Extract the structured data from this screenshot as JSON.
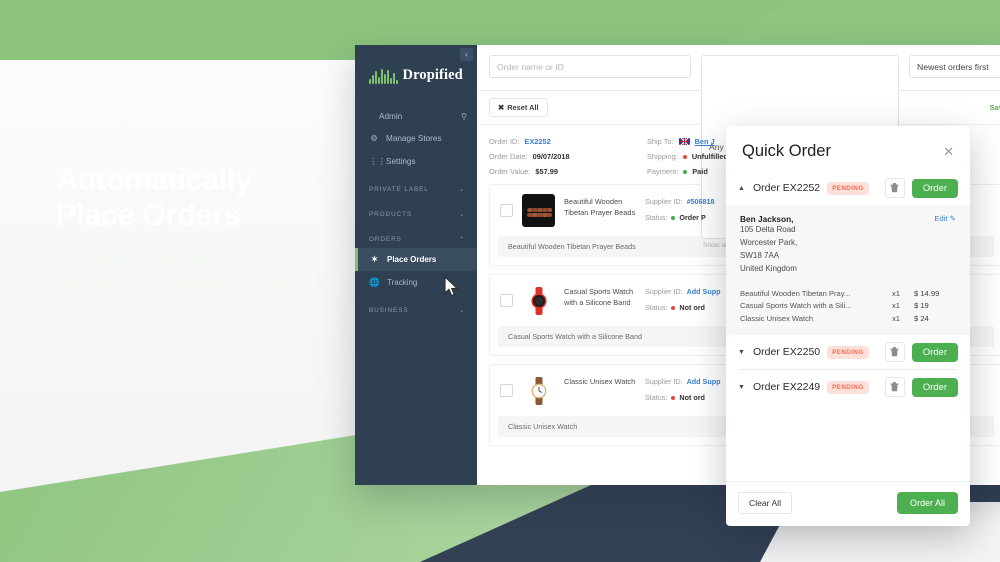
{
  "promo": {
    "headline_line1": "Automatically",
    "headline_line2": "Place Orders",
    "sub_line1": "Knock out your order queue",
    "sub_line2": "with the click of ONE BUTTON"
  },
  "sidebar": {
    "brand": "Dropified",
    "collapse_icon": "‹",
    "admin": {
      "label": "Admin",
      "search_icon": "search-icon"
    },
    "top_items": [
      {
        "label": "Manage Stores",
        "icon": "gear-icon"
      },
      {
        "label": "Settings",
        "icon": "sliders-icon"
      }
    ],
    "sections": [
      {
        "label": "PRIVATE LABEL",
        "caret": "⌄",
        "items": []
      },
      {
        "label": "PRODUCTS",
        "caret": "⌄",
        "items": []
      },
      {
        "label": "ORDERS",
        "caret": "⌃",
        "items": [
          {
            "label": "Place Orders",
            "icon": "target-icon",
            "active": true
          },
          {
            "label": "Tracking",
            "icon": "globe-icon",
            "active": false
          }
        ]
      },
      {
        "label": "BUSINESS",
        "caret": "⌄",
        "items": []
      }
    ]
  },
  "filters": {
    "search_placeholder": "Order name or ID",
    "status_value": "Any",
    "status_hint": "Show all Authorized, Pending, and Paid orders",
    "sort_value": "Newest orders first",
    "reset_label": "Reset All",
    "reset_icon": "✖",
    "save_label": "Sav",
    "caret_icon": "⌄"
  },
  "order": {
    "order_id_label": "Order ID:",
    "order_id_value": "EX2252",
    "order_date_label": "Order Date:",
    "order_date_value": "09/07/2018",
    "order_value_label": "Order Value:",
    "order_value_value": "$57.99",
    "ship_to_label": "Ship To:",
    "ship_to_value": "Ben J",
    "shipping_label": "Shipping:",
    "shipping_value": "Unfulfilled",
    "payment_label": "Payment:",
    "payment_value": "Paid",
    "products": [
      {
        "name": "Beautiful Wooden Tibetan Prayer Beads",
        "footer": "Beautiful Wooden Tibetan Prayer Beads",
        "supplier_label": "Supplier ID:",
        "supplier_value": "#506818",
        "status_label": "Status:",
        "status_value": "Order P",
        "status_color": "green",
        "thumb": "beads"
      },
      {
        "name": "Casual Sports Watch with a Silicone Band",
        "footer": "Casual Sports Watch with a Silicone Band",
        "supplier_label": "Supplier ID:",
        "supplier_value": "Add Supp",
        "status_label": "Status:",
        "status_value": "Not ord",
        "status_color": "red",
        "thumb": "sports"
      },
      {
        "name": "Classic Unisex Watch",
        "footer": "Classic Unisex Watch",
        "supplier_label": "Supplier ID:",
        "supplier_value": "Add Supp",
        "status_label": "Status:",
        "status_value": "Not ord",
        "status_color": "red",
        "thumb": "classic"
      }
    ]
  },
  "quick_order": {
    "title": "Quick Order",
    "close_icon": "✕",
    "orders": [
      {
        "caret": "▲",
        "label": "Order EX2252",
        "badge": "PENDING",
        "delete_icon": "trash-icon",
        "order_button": "Order",
        "expanded": true
      },
      {
        "caret": "▼",
        "label": "Order EX2250",
        "badge": "PENDING",
        "delete_icon": "trash-icon",
        "order_button": "Order",
        "expanded": false
      },
      {
        "caret": "▼",
        "label": "Order EX2249",
        "badge": "PENDING",
        "delete_icon": "trash-icon",
        "order_button": "Order",
        "expanded": false
      }
    ],
    "address": {
      "name": "Ben Jackson,",
      "edit_label": "Edit",
      "edit_icon": "pencil-icon",
      "lines": [
        "105 Delta Road",
        "Worcester Park,",
        "SW18 7AA",
        "United Kingdom"
      ]
    },
    "items": [
      {
        "name": "Beautiful Wooden Tibetan Pray...",
        "qty": "x1",
        "price": "$ 14.99"
      },
      {
        "name": "Casual Sports Watch with a Sili...",
        "qty": "x1",
        "price": "$ 19"
      },
      {
        "name": "Classic Unisex Watch",
        "qty": "x1",
        "price": "$ 24"
      }
    ],
    "footer": {
      "clear_label": "Clear All",
      "order_all_label": "Order All"
    }
  },
  "colors": {
    "brand_green": "#8cc47e",
    "button_green": "#4caf50",
    "sidebar_navy": "#2e4052",
    "accent_navy": "#334155",
    "badge_bg": "#fde1d8",
    "badge_text": "#f4694b",
    "link_blue": "#3a80d4"
  }
}
